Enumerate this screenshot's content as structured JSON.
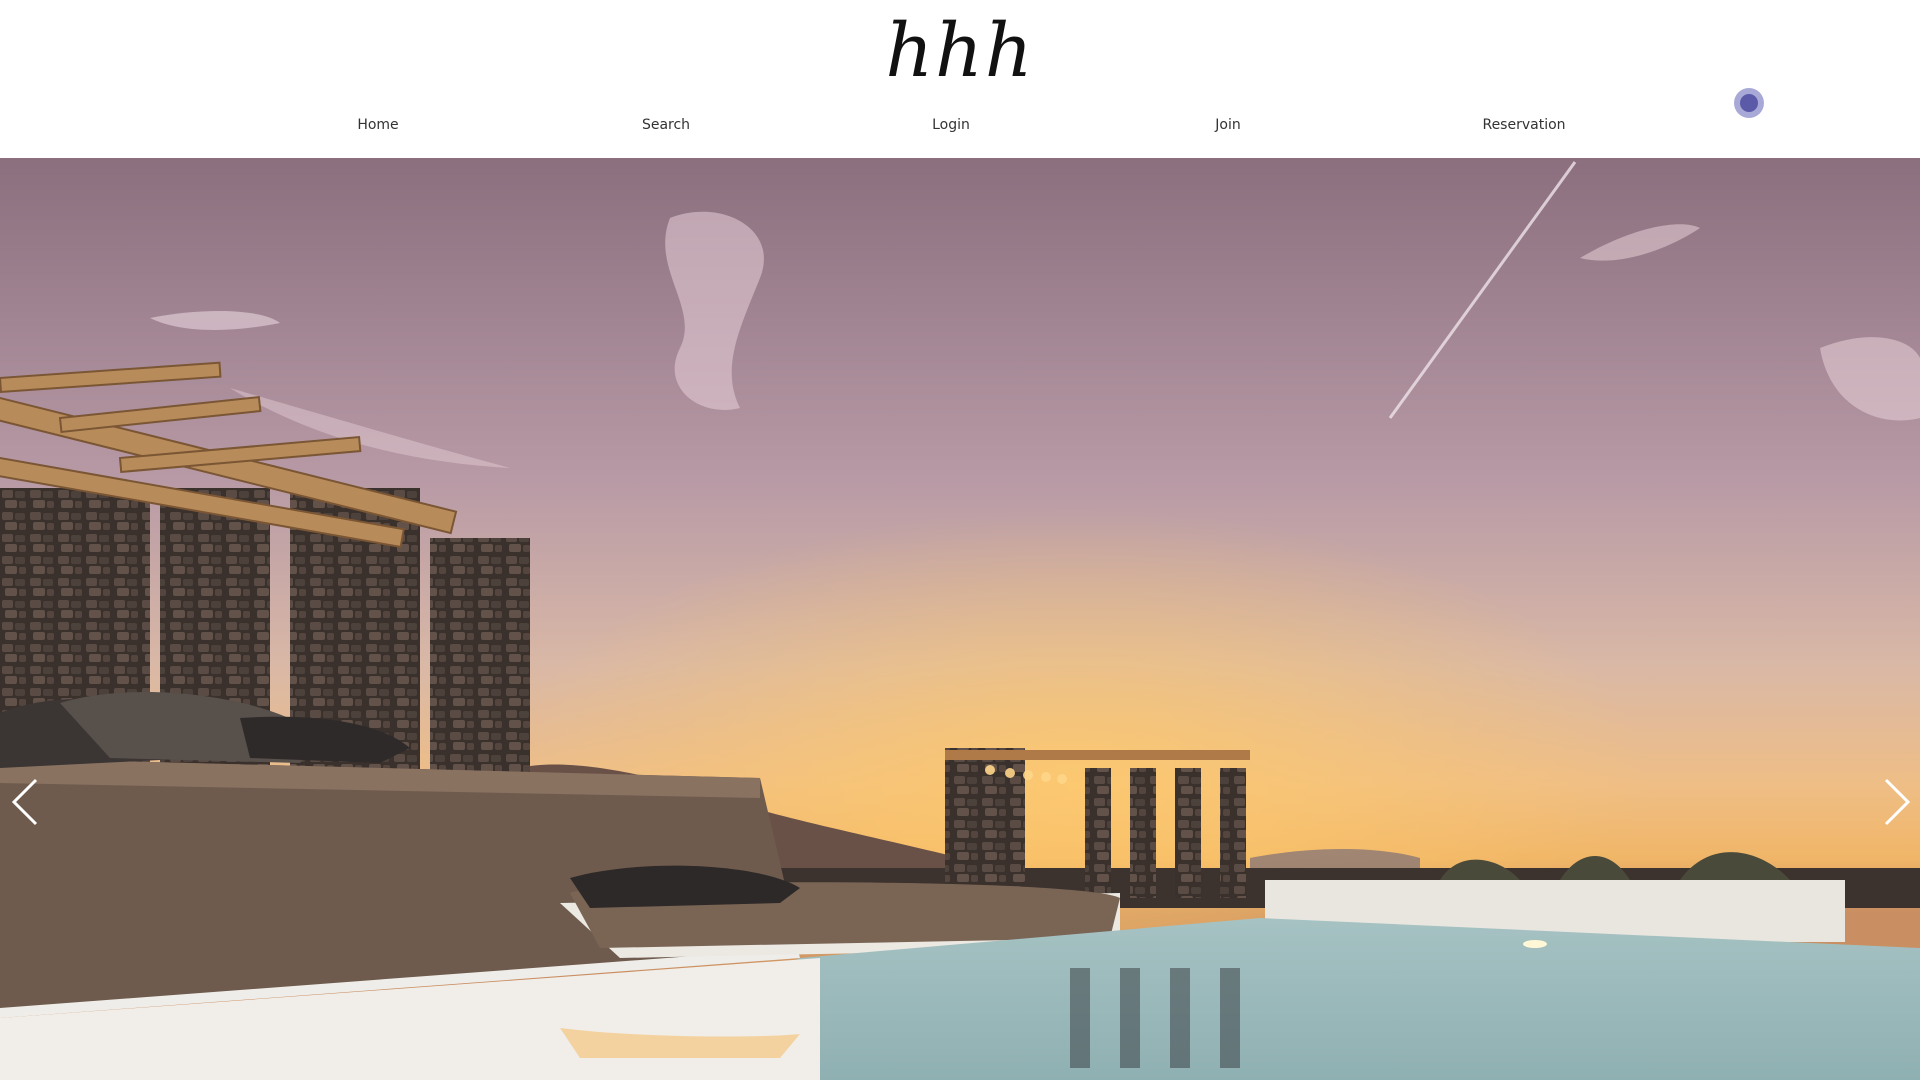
{
  "brand": {
    "logo": "hhh"
  },
  "nav": {
    "items": [
      {
        "label": "Home"
      },
      {
        "label": "Search"
      },
      {
        "label": "Login"
      },
      {
        "label": "Join"
      },
      {
        "label": "Reservation"
      }
    ]
  },
  "colors": {
    "header_bg": "#ffffff",
    "status_dot": "#5a5aa8",
    "sky_top": "#8a6f7d",
    "sunset_glow": "#f2b25a"
  },
  "icons": {
    "status": "status-dot-icon",
    "prev": "chevron-left-icon",
    "next": "chevron-right-icon"
  }
}
